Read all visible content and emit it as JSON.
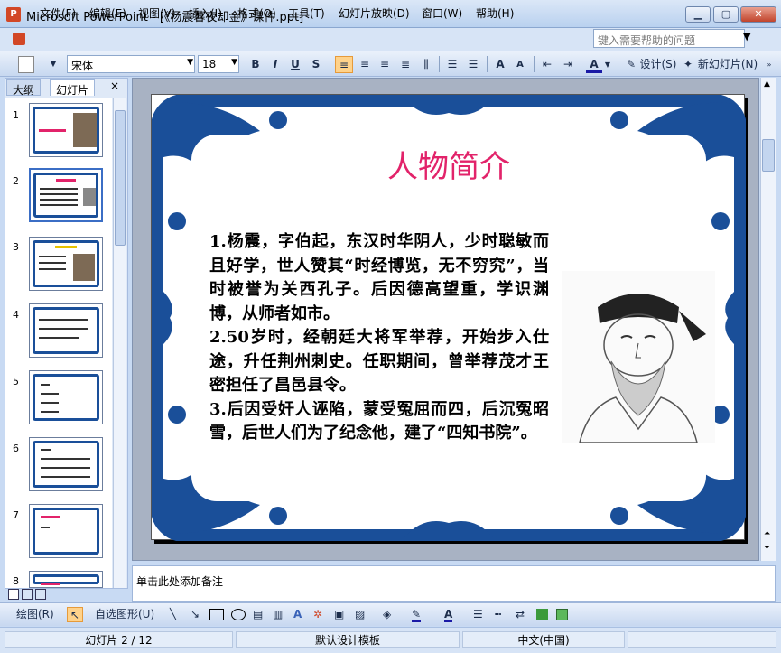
{
  "window": {
    "app_icon": "powerpoint-icon",
    "title": "Microsoft PowerPoint - [《杨震暮夜却金》课件.ppt]",
    "minimize": "minimize-icon",
    "maximize": "restore-icon",
    "close": "close-icon"
  },
  "menu": {
    "items": [
      "文件(F)",
      "编辑(E)",
      "视图(V)",
      "插入(I)",
      "格式(O)",
      "工具(T)",
      "幻灯片放映(D)",
      "窗口(W)",
      "帮助(H)"
    ],
    "help_placeholder": "键入需要帮助的问题"
  },
  "toolbar": {
    "font": "宋体",
    "size": "18",
    "bold": "B",
    "italic": "I",
    "underline": "U",
    "shadow": "S",
    "font_color_letter": "A",
    "grow": "A",
    "shrink": "A",
    "design": "设计(S)",
    "new_slide": "新幻灯片(N)"
  },
  "pane": {
    "tabs": [
      "大纲",
      "幻灯片"
    ],
    "close": "×",
    "slide_numbers": [
      "1",
      "2",
      "3",
      "4",
      "5",
      "6",
      "7",
      "8"
    ],
    "selected": 2
  },
  "slide": {
    "title": "人物简介",
    "body": [
      "1.杨震，字伯起，东汉时华阴人，少时聪敏而且好学，世人赞其“时经博览，无不穷究”，当时被誉为关西孔子。后因德高望重，学识渊博，从师者如市。",
      "2.50岁时，经朝廷大将军举荐，开始步入仕途，升任荆州刺史。任职期间，曾举荐茂才王密担任了昌邑县令。",
      "3.后因受奸人诬陷，蒙受冤屈而四，后沉冤昭雪，后世人们为了纪念他，建了“四知书院”。"
    ],
    "frame_color": "#1a4f99",
    "title_color": "#e2236a"
  },
  "notes": {
    "placeholder": "单击此处添加备注"
  },
  "drawbar": {
    "draw": "绘图(R)",
    "autoshape": "自选图形(U)"
  },
  "status": {
    "slide": "幻灯片 2 / 12",
    "template": "默认设计模板",
    "language": "中文(中国)"
  }
}
